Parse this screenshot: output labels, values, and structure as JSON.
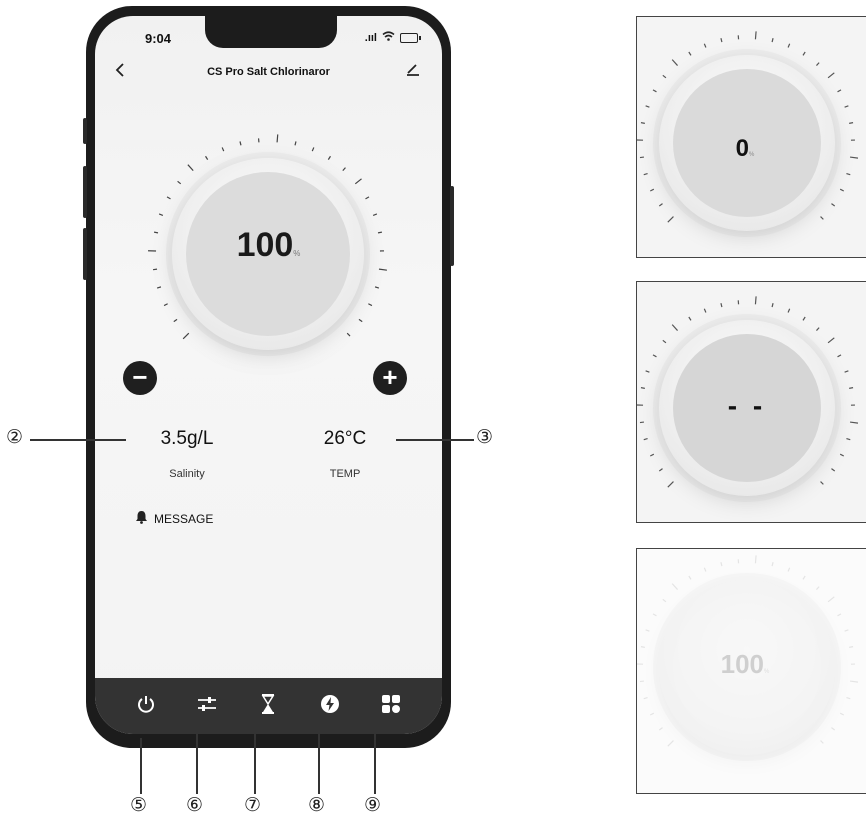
{
  "status": {
    "time": "9:04",
    "signal": ".ııl"
  },
  "header": {
    "title": "CS Pro Salt Chlorinaror",
    "back_icon": "chevron-left-icon",
    "edit_icon": "edit-icon"
  },
  "dial": {
    "value": "100",
    "unit": "%",
    "level": 1.0
  },
  "controls": {
    "minus": "−",
    "plus": "+"
  },
  "readings": {
    "salinity": {
      "value": "3.5g/L",
      "label": "Salinity"
    },
    "temp": {
      "value": "26°C",
      "label": "TEMP"
    }
  },
  "message": {
    "label": "MESSAGE",
    "icon": "bell-icon"
  },
  "tabs": [
    {
      "icon": "power-icon"
    },
    {
      "icon": "sliders-icon"
    },
    {
      "icon": "hourglass-icon"
    },
    {
      "icon": "lightning-icon"
    },
    {
      "icon": "grid-icon"
    }
  ],
  "callouts": {
    "salinity": "②",
    "temp": "③",
    "tab_power": "⑤",
    "tab_sliders": "⑥",
    "tab_timer": "⑦",
    "tab_boost": "⑧",
    "tab_more": "⑨"
  },
  "panels": [
    {
      "value": "0",
      "unit": "%"
    },
    {
      "value": "- -",
      "unit": ""
    },
    {
      "value": "100",
      "unit": "%"
    }
  ],
  "colors": {
    "phone_frame": "#1c1c1c",
    "tabbar": "#333333",
    "dial_face": "#dcdcdc"
  }
}
